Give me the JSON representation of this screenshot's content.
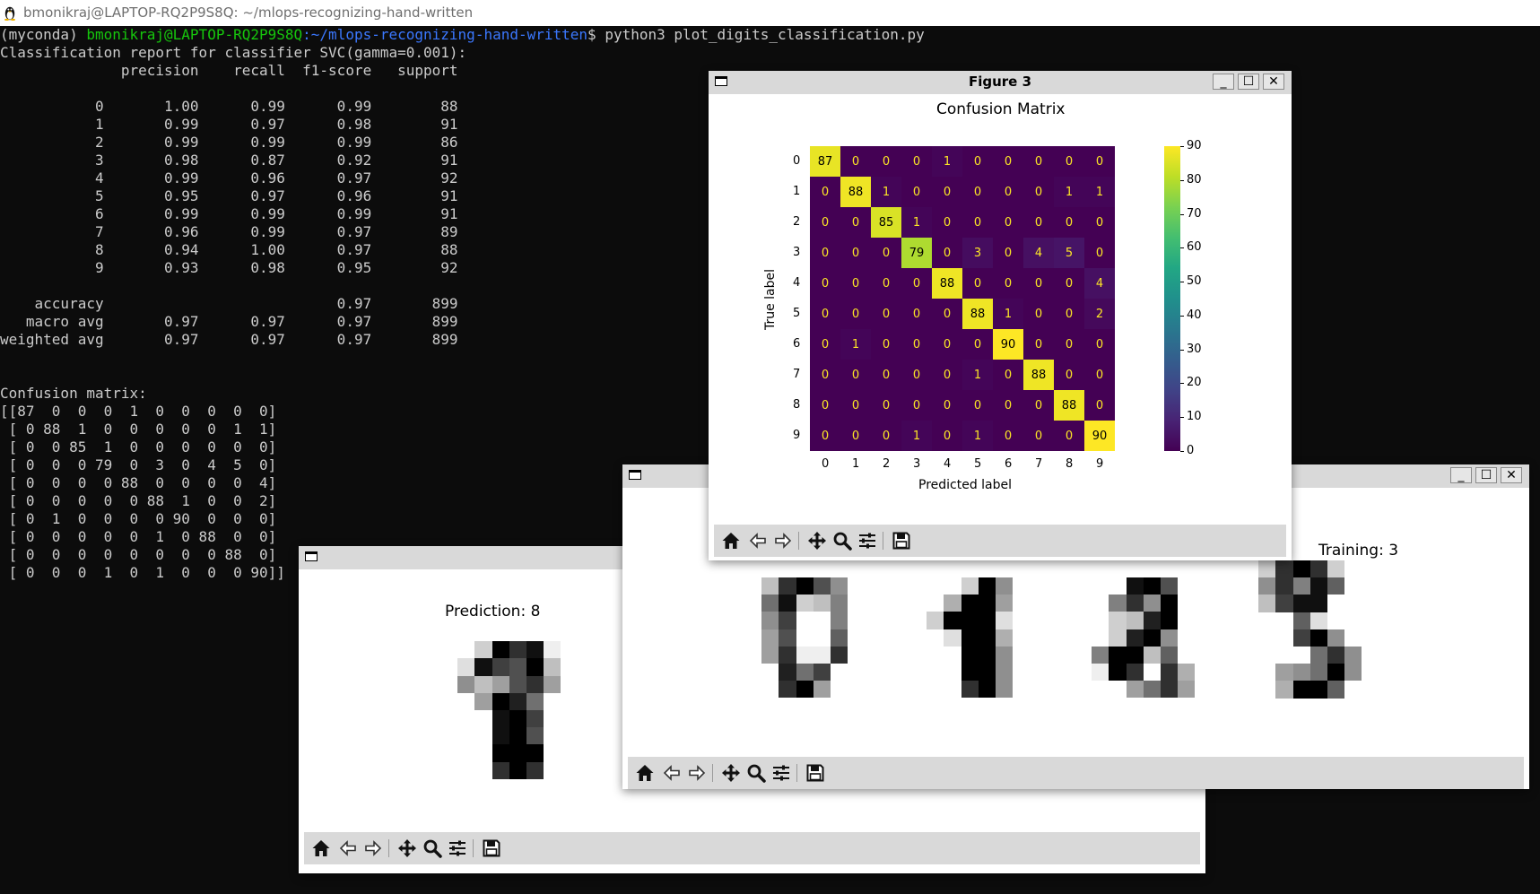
{
  "terminal": {
    "window_title": "bmonikraj@LAPTOP-RQ2P9S8Q: ~/mlops-recognizing-hand-written",
    "prompt_env": "(myconda) ",
    "prompt_user_host": "bmonikraj@LAPTOP-RQ2P9S8Q",
    "prompt_path": ":~/mlops-recognizing-hand-written",
    "prompt_symbol": "$ ",
    "command": "python3 plot_digits_classification.py",
    "output": "Classification report for classifier SVC(gamma=0.001):\n              precision    recall  f1-score   support\n\n           0       1.00      0.99      0.99        88\n           1       0.99      0.97      0.98        91\n           2       0.99      0.99      0.99        86\n           3       0.98      0.87      0.92        91\n           4       0.99      0.96      0.97        92\n           5       0.95      0.97      0.96        91\n           6       0.99      0.99      0.99        91\n           7       0.96      0.99      0.97        89\n           8       0.94      1.00      0.97        88\n           9       0.93      0.98      0.95        92\n\n    accuracy                           0.97       899\n   macro avg       0.97      0.97      0.97       899\nweighted avg       0.97      0.97      0.97       899\n\n\nConfusion matrix:\n[[87  0  0  0  1  0  0  0  0  0]\n [ 0 88  1  0  0  0  0  0  1  1]\n [ 0  0 85  1  0  0  0  0  0  0]\n [ 0  0  0 79  0  3  0  4  5  0]\n [ 0  0  0  0 88  0  0  0  0  4]\n [ 0  0  0  0  0 88  1  0  0  2]\n [ 0  1  0  0  0  0 90  0  0  0]\n [ 0  0  0  0  0  1  0 88  0  0]\n [ 0  0  0  0  0  0  0  0 88  0]\n [ 0  0  0  1  0  1  0  0  0 90]]"
  },
  "figure3": {
    "title": "Figure 3",
    "minimize_label": "_",
    "maximize_label": "☐",
    "close_label": "✕"
  },
  "figure_prediction": {
    "title": "Prediction: 8"
  },
  "figure_training": {
    "visible_title": "Training: 3"
  },
  "toolbar_icons": [
    "home-icon",
    "back-arrow-icon",
    "forward-arrow-icon",
    "pan-icon",
    "zoom-icon",
    "configure-subplots-icon",
    "save-icon"
  ],
  "chart_data": {
    "type": "heatmap",
    "title": "Confusion Matrix",
    "xlabel": "Predicted label",
    "ylabel": "True label",
    "x_categories": [
      "0",
      "1",
      "2",
      "3",
      "4",
      "5",
      "6",
      "7",
      "8",
      "9"
    ],
    "y_categories": [
      "0",
      "1",
      "2",
      "3",
      "4",
      "5",
      "6",
      "7",
      "8",
      "9"
    ],
    "values": [
      [
        87,
        0,
        0,
        0,
        1,
        0,
        0,
        0,
        0,
        0
      ],
      [
        0,
        88,
        1,
        0,
        0,
        0,
        0,
        0,
        1,
        1
      ],
      [
        0,
        0,
        85,
        1,
        0,
        0,
        0,
        0,
        0,
        0
      ],
      [
        0,
        0,
        0,
        79,
        0,
        3,
        0,
        4,
        5,
        0
      ],
      [
        0,
        0,
        0,
        0,
        88,
        0,
        0,
        0,
        0,
        4
      ],
      [
        0,
        0,
        0,
        0,
        0,
        88,
        1,
        0,
        0,
        2
      ],
      [
        0,
        1,
        0,
        0,
        0,
        0,
        90,
        0,
        0,
        0
      ],
      [
        0,
        0,
        0,
        0,
        0,
        1,
        0,
        88,
        0,
        0
      ],
      [
        0,
        0,
        0,
        0,
        0,
        0,
        0,
        0,
        88,
        0
      ],
      [
        0,
        0,
        0,
        1,
        0,
        1,
        0,
        0,
        0,
        90
      ]
    ],
    "colormap": "viridis",
    "colorbar_range": [
      0,
      90
    ],
    "colorbar_ticks": [
      0,
      10,
      20,
      30,
      40,
      50,
      60,
      70,
      80,
      90
    ]
  },
  "digit_images": {
    "prediction": [
      [
        0,
        0,
        0,
        0,
        0,
        0,
        0,
        0
      ],
      [
        0,
        0,
        3,
        16,
        13,
        15,
        1,
        0
      ],
      [
        0,
        2,
        15,
        12,
        11,
        16,
        4,
        0
      ],
      [
        0,
        7,
        4,
        6,
        11,
        13,
        6,
        0
      ],
      [
        0,
        0,
        6,
        16,
        14,
        9,
        0,
        0
      ],
      [
        0,
        0,
        0,
        15,
        16,
        12,
        0,
        0
      ],
      [
        0,
        0,
        0,
        15,
        16,
        11,
        0,
        0
      ],
      [
        0,
        0,
        0,
        16,
        16,
        16,
        0,
        0
      ],
      [
        0,
        0,
        0,
        13,
        16,
        13,
        0,
        0
      ]
    ],
    "training_0": [
      [
        0,
        4,
        13,
        16,
        11,
        7,
        0,
        0
      ],
      [
        0,
        9,
        15,
        3,
        4,
        8,
        0,
        0
      ],
      [
        0,
        7,
        12,
        0,
        0,
        8,
        0,
        0
      ],
      [
        0,
        6,
        11,
        0,
        0,
        10,
        0,
        0
      ],
      [
        0,
        6,
        13,
        1,
        1,
        13,
        0,
        0
      ],
      [
        0,
        0,
        14,
        9,
        12,
        0,
        0,
        0
      ],
      [
        0,
        0,
        13,
        16,
        6,
        0,
        0,
        0
      ]
    ],
    "training_1": [
      [
        0,
        0,
        0,
        3,
        16,
        7,
        0,
        0
      ],
      [
        0,
        0,
        5,
        16,
        16,
        6,
        0,
        0
      ],
      [
        0,
        3,
        16,
        16,
        16,
        2,
        0,
        0
      ],
      [
        0,
        0,
        2,
        16,
        16,
        5,
        0,
        0
      ],
      [
        0,
        0,
        0,
        16,
        16,
        7,
        0,
        0
      ],
      [
        0,
        0,
        0,
        16,
        16,
        7,
        0,
        0
      ],
      [
        0,
        0,
        0,
        13,
        16,
        7,
        0,
        0
      ]
    ],
    "training_2": [
      [
        0,
        0,
        0,
        15,
        16,
        11,
        0,
        0
      ],
      [
        0,
        0,
        8,
        13,
        7,
        16,
        0,
        0
      ],
      [
        0,
        0,
        3,
        4,
        14,
        16,
        0,
        0
      ],
      [
        0,
        0,
        3,
        14,
        16,
        7,
        0,
        0
      ],
      [
        0,
        8,
        16,
        16,
        4,
        10,
        0,
        0
      ],
      [
        0,
        1,
        16,
        13,
        0,
        13,
        5,
        0
      ],
      [
        0,
        0,
        0,
        6,
        9,
        13,
        6,
        0
      ]
    ],
    "training_3": [
      [
        0,
        3,
        13,
        16,
        13,
        3,
        0,
        0
      ],
      [
        0,
        7,
        13,
        8,
        15,
        10,
        0,
        0
      ],
      [
        0,
        4,
        12,
        15,
        15,
        0,
        0,
        0
      ],
      [
        0,
        0,
        0,
        10,
        2,
        0,
        0,
        0
      ],
      [
        0,
        0,
        0,
        12,
        16,
        7,
        0,
        0
      ],
      [
        0,
        0,
        0,
        0,
        9,
        13,
        7,
        0
      ],
      [
        0,
        0,
        6,
        7,
        9,
        16,
        7,
        0
      ],
      [
        0,
        0,
        5,
        16,
        16,
        10,
        0,
        0
      ]
    ]
  }
}
